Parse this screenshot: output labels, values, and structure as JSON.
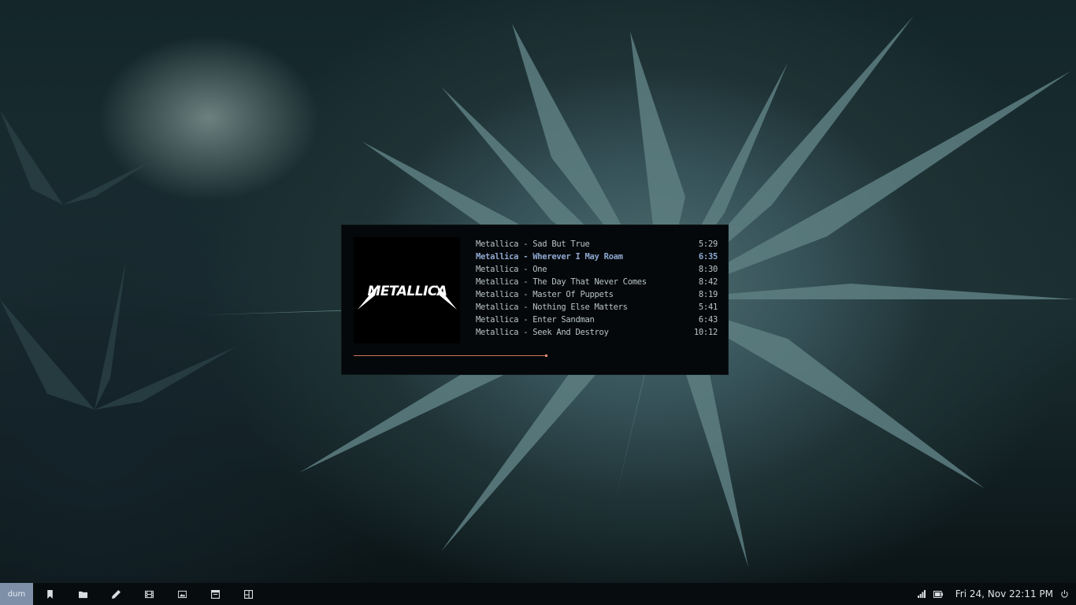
{
  "player": {
    "album_art": {
      "logo_text": "METALLICA"
    },
    "tracks": [
      {
        "title": "Metallica - Sad But True",
        "duration": "5:29",
        "active": false
      },
      {
        "title": "Metallica - Wherever I May Roam",
        "duration": "6:35",
        "active": true
      },
      {
        "title": "Metallica - One",
        "duration": "8:30",
        "active": false
      },
      {
        "title": "Metallica - The Day That Never Comes",
        "duration": "8:42",
        "active": false
      },
      {
        "title": "Metallica - Master Of Puppets",
        "duration": "8:19",
        "active": false
      },
      {
        "title": "Metallica - Nothing Else Matters",
        "duration": "5:41",
        "active": false
      },
      {
        "title": "Metallica - Enter Sandman",
        "duration": "6:43",
        "active": false
      },
      {
        "title": "Metallica - Seek And Destroy",
        "duration": "10:12",
        "active": false
      }
    ],
    "progress_fraction": 0.53,
    "colors": {
      "active_track": "#8fa8d0",
      "progress": "#c8745a",
      "text": "#b9c4c6"
    }
  },
  "taskbar": {
    "workspace_label": "dum",
    "launchers": [
      {
        "name": "bookmark-icon"
      },
      {
        "name": "folder-icon"
      },
      {
        "name": "pencil-icon"
      },
      {
        "name": "film-icon"
      },
      {
        "name": "image-icon"
      },
      {
        "name": "window-icon"
      },
      {
        "name": "layout-icon"
      }
    ],
    "tray": {
      "signal_icon": "signal-bars-icon",
      "battery_icon": "battery-icon",
      "clock": "Fri 24, Nov 22:11 PM",
      "power_icon": "power-icon"
    },
    "colors": {
      "workspace_bg": "#7e8fa8",
      "bar_bg": "#070c0e"
    }
  }
}
